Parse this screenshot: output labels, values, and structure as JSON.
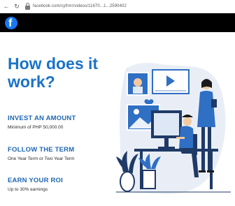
{
  "browser": {
    "back_icon": "back-arrow-icon",
    "reload_icon": "reload-icon",
    "lock_icon": "lock-icon",
    "url": "facebook.com/cyfrmr/videos/11670...1...2590402"
  },
  "site": {
    "logo_letter": "f",
    "brand_color": "#1877f2",
    "bar_color": "#000000"
  },
  "main": {
    "heading": "How does it work?",
    "accent_color": "#1a73c8",
    "steps": [
      {
        "title": "INVEST AN AMOUNT",
        "subtitle": "Minimum of PHP 50,000.00"
      },
      {
        "title": "FOLLOW THE TERM",
        "subtitle": "One Year Term or Two Year Term"
      },
      {
        "title": "EARN YOUR ROI",
        "subtitle": "Up to 30% earnings"
      }
    ]
  }
}
